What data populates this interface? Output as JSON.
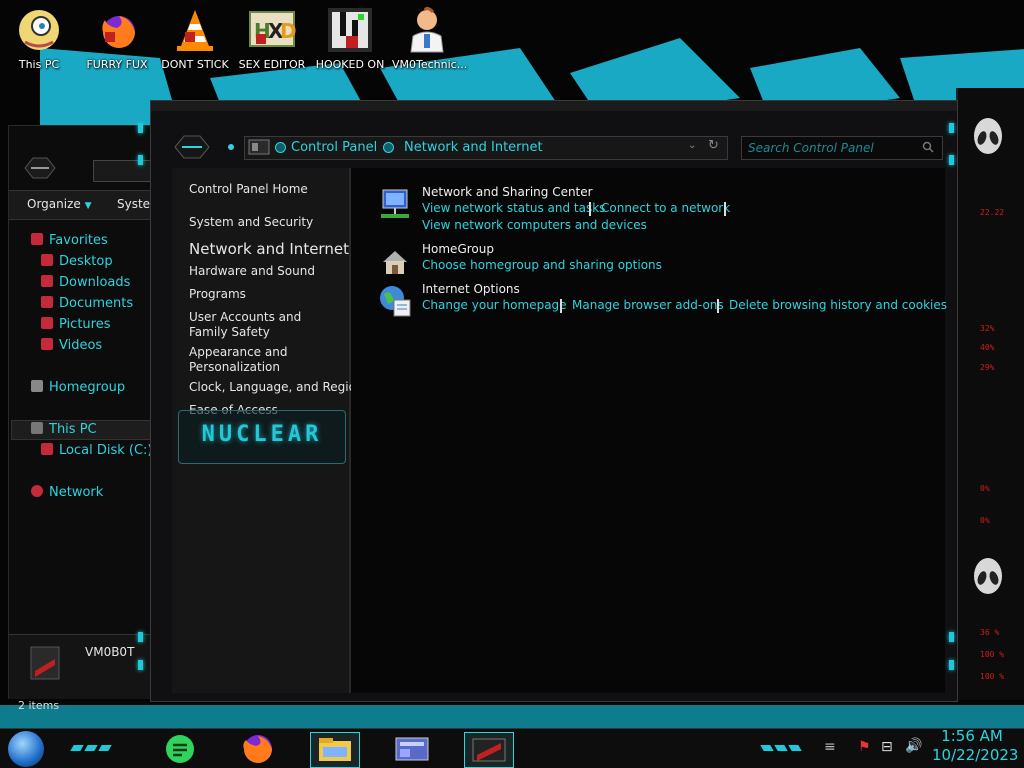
{
  "desktop": {
    "icons": [
      {
        "label": "This PC",
        "icon": "cartoon-face-icon"
      },
      {
        "label": "FURRY FUX",
        "icon": "firefox-icon"
      },
      {
        "label": "DONT STICK",
        "icon": "vlc-cone-icon"
      },
      {
        "label": "SEX EDITOR",
        "icon": "hxd-editor-icon"
      },
      {
        "label": "HOOKED ON",
        "icon": "game-icon"
      },
      {
        "label": "VM0Technic...",
        "icon": "doctor-icon"
      }
    ],
    "widget_label": "NUCLEAR",
    "side_readouts": [
      "22.22",
      "32%",
      "40%",
      "29%",
      "0%",
      "0%",
      "36 %",
      "100 %",
      "100 %"
    ]
  },
  "explorer": {
    "toolbar": {
      "organize": "Organize",
      "system": "Syste"
    },
    "nav": [
      {
        "label": "Favorites",
        "icon": "star-icon"
      },
      {
        "label": "Desktop",
        "icon": "desktop-icon"
      },
      {
        "label": "Downloads",
        "icon": "download-icon"
      },
      {
        "label": "Documents",
        "icon": "documents-icon"
      },
      {
        "label": "Pictures",
        "icon": "pictures-icon"
      },
      {
        "label": "Videos",
        "icon": "videos-icon"
      },
      {
        "label": "Homegroup",
        "icon": "homegroup-icon"
      },
      {
        "label": "This PC",
        "icon": "computer-icon"
      },
      {
        "label": "Local Disk (C:)",
        "icon": "disk-icon"
      },
      {
        "label": "Network",
        "icon": "network-icon"
      }
    ],
    "computer_name": "VM0B0T",
    "status": "2 items"
  },
  "control_panel": {
    "breadcrumb": [
      "Control Panel",
      "Network and Internet"
    ],
    "search_placeholder": "Search Control Panel",
    "left_links": {
      "home": "Control Panel Home",
      "items": [
        "System and Security",
        "Network and Internet",
        "Hardware and Sound",
        "Programs",
        "User Accounts and Family Safety",
        "Appearance and Personalization",
        "Clock, Language, and Region",
        "Ease of Access"
      ],
      "current": "Network and Internet"
    },
    "categories": [
      {
        "title": "Network and Sharing Center",
        "icon": "network-sharing-icon",
        "links": [
          "View network status and tasks",
          "Connect to a network",
          "View network computers and devices"
        ]
      },
      {
        "title": "HomeGroup",
        "icon": "homegroup-house-icon",
        "links": [
          "Choose homegroup and sharing options"
        ]
      },
      {
        "title": "Internet Options",
        "icon": "internet-options-icon",
        "links": [
          "Change your homepage",
          "Manage browser add-ons",
          "Delete browsing history and cookies"
        ]
      }
    ]
  },
  "taskbar": {
    "time": "1:56 AM",
    "date": "10/22/2023",
    "pinned": [
      "start-orb-icon",
      "notes-app-icon",
      "firefox-taskbar-icon",
      "file-explorer-icon",
      "control-panel-icon",
      "screen-app-icon"
    ]
  },
  "colors": {
    "accent": "#2bd4e0",
    "text": "#e6e6e6",
    "red": "#d21c1c",
    "frame": "#1a1a1a"
  }
}
